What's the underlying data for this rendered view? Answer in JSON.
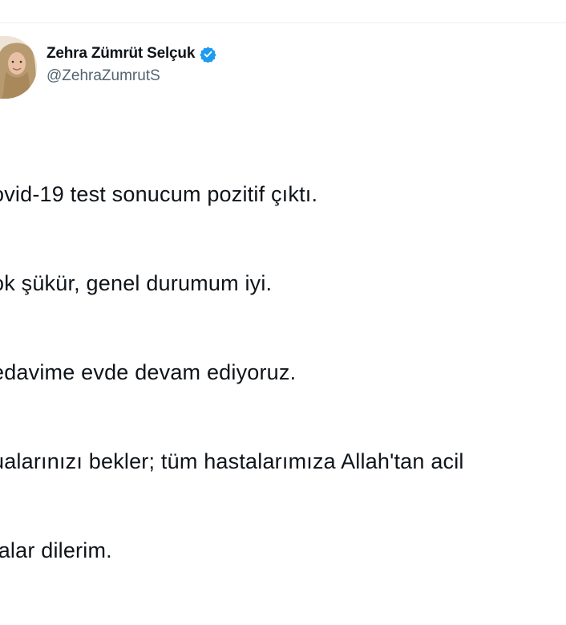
{
  "tweet": {
    "author_name": "Zehra Zümrüt Selçuk",
    "author_handle": "@ZehraZumrutS",
    "verified_icon": "verified-badge-icon",
    "accent_color": "#1d9bf0",
    "lines": [
      "ovid-19 test sonucum pozitif çıktı.",
      "ok şükür, genel durumum iyi.",
      "edavime evde devam ediyoruz.",
      "ualarınızı bekler; tüm hastalarımıza Allah'tan acil",
      "falar dilerim."
    ]
  }
}
